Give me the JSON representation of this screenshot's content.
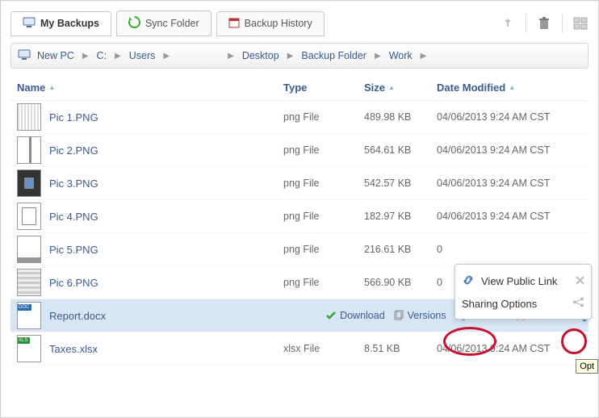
{
  "tabs": {
    "my_backups": "My Backups",
    "sync_folder": "Sync Folder",
    "backup_history": "Backup History"
  },
  "breadcrumb": {
    "parts": [
      "New PC",
      "C:",
      "Users",
      "",
      "Desktop",
      "Backup Folder",
      "Work"
    ]
  },
  "columns": {
    "name": "Name",
    "type": "Type",
    "size": "Size",
    "date": "Date Modified"
  },
  "files": [
    {
      "name": "Pic 1.PNG",
      "type": "png File",
      "size": "489.98 KB",
      "date": "04/06/2013 9:24 AM CST",
      "kind": "png"
    },
    {
      "name": "Pic 2.PNG",
      "type": "png File",
      "size": "564.61 KB",
      "date": "04/06/2013 9:24 AM CST",
      "kind": "png"
    },
    {
      "name": "Pic 3.PNG",
      "type": "png File",
      "size": "542.57 KB",
      "date": "04/06/2013 9:24 AM CST",
      "kind": "png"
    },
    {
      "name": "Pic 4.PNG",
      "type": "png File",
      "size": "182.97 KB",
      "date": "04/06/2013 9:24 AM CST",
      "kind": "png"
    },
    {
      "name": "Pic 5.PNG",
      "type": "png File",
      "size": "216.61 KB",
      "date": "0",
      "kind": "png"
    },
    {
      "name": "Pic 6.PNG",
      "type": "png File",
      "size": "566.90 KB",
      "date": "0",
      "kind": "png"
    },
    {
      "name": "Report.docx",
      "type": "",
      "size": "",
      "date": "",
      "kind": "doc",
      "selected": true
    },
    {
      "name": "Taxes.xlsx",
      "type": "xlsx File",
      "size": "8.51 KB",
      "date": "04/06/2013 9:24 AM CST",
      "kind": "xls"
    }
  ],
  "row_actions": {
    "download": "Download",
    "versions": "Versions",
    "unshare": "Unshare",
    "delete": "Delete"
  },
  "popup": {
    "view_public": "View Public Link",
    "sharing_options": "Sharing Options"
  },
  "tooltip": "Opt"
}
